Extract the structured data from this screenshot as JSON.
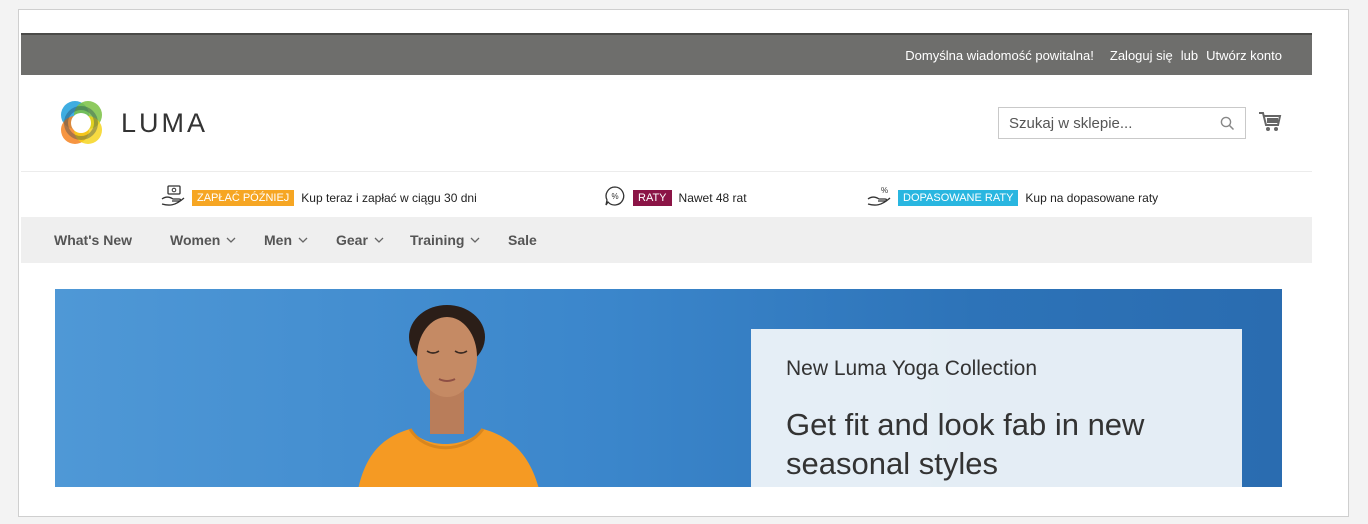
{
  "topbar": {
    "welcome": "Domyślna wiadomość powitalna!",
    "sign_in": "Zaloguj się",
    "or": "lub",
    "create_account": "Utwórz konto",
    "bg_color": "#6e6e6c"
  },
  "header": {
    "logo_text": "LUMA",
    "search": {
      "placeholder": "Szukaj w sklepie..."
    },
    "cart_icon": "cart-icon",
    "search_icon": "magnifier-icon"
  },
  "promo": [
    {
      "icon": "hand-money-icon",
      "badge": "ZAPŁAĆ PÓŹNIEJ",
      "badge_color": "#f6a623",
      "text": "Kup teraz i zapłać w ciągu 30 dni"
    },
    {
      "icon": "percent-bubble-icon",
      "badge": "RATY",
      "badge_color": "#8b1446",
      "text": "Nawet 48 rat"
    },
    {
      "icon": "hand-percent-icon",
      "badge": "DOPASOWANE RATY",
      "badge_color": "#29b6e0",
      "text": "Kup na dopasowane raty"
    }
  ],
  "nav": {
    "items": [
      {
        "label": "What's New",
        "dropdown": false
      },
      {
        "label": "Women",
        "dropdown": true
      },
      {
        "label": "Men",
        "dropdown": true
      },
      {
        "label": "Gear",
        "dropdown": true
      },
      {
        "label": "Training",
        "dropdown": true
      },
      {
        "label": "Sale",
        "dropdown": false
      }
    ]
  },
  "hero": {
    "subtitle": "New Luma Yoga Collection",
    "title": "Get fit and look fab in new seasonal styles",
    "bg_color": "#3b86cb",
    "shirt_color": "#f59a23"
  }
}
